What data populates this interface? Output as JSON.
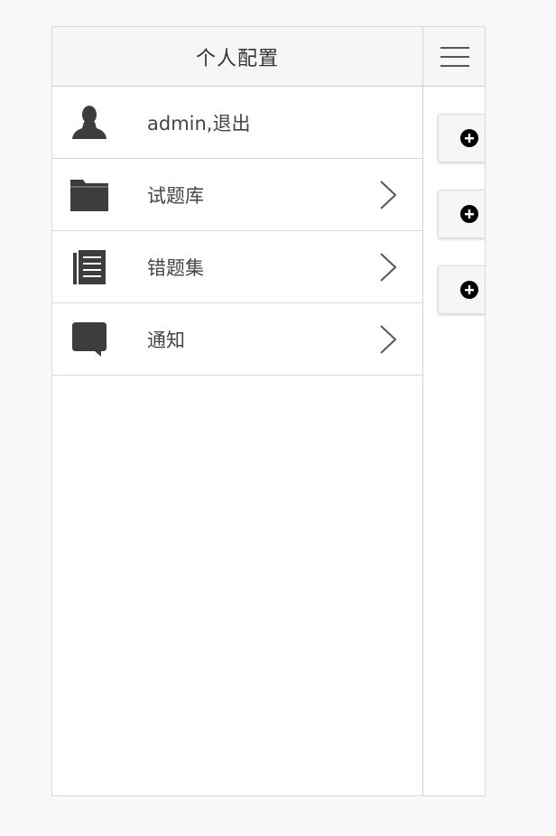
{
  "panel": {
    "title": "个人配置",
    "items": [
      {
        "label": "admin,退出",
        "icon": "user-icon",
        "chevron": false
      },
      {
        "label": "试题库",
        "icon": "folder-icon",
        "chevron": true
      },
      {
        "label": "错题集",
        "icon": "list-document-icon",
        "chevron": true
      },
      {
        "label": "通知",
        "icon": "chat-bubble-icon",
        "chevron": true
      }
    ]
  },
  "strip": {
    "menu_icon": "hamburger-menu-icon",
    "add_buttons": [
      "plus-circle-icon",
      "plus-circle-icon",
      "plus-circle-icon"
    ]
  },
  "colors": {
    "icon": "#3d3d3d",
    "text": "#444444",
    "header_bg": "#f6f6f6",
    "divider": "#d8d8d8"
  }
}
